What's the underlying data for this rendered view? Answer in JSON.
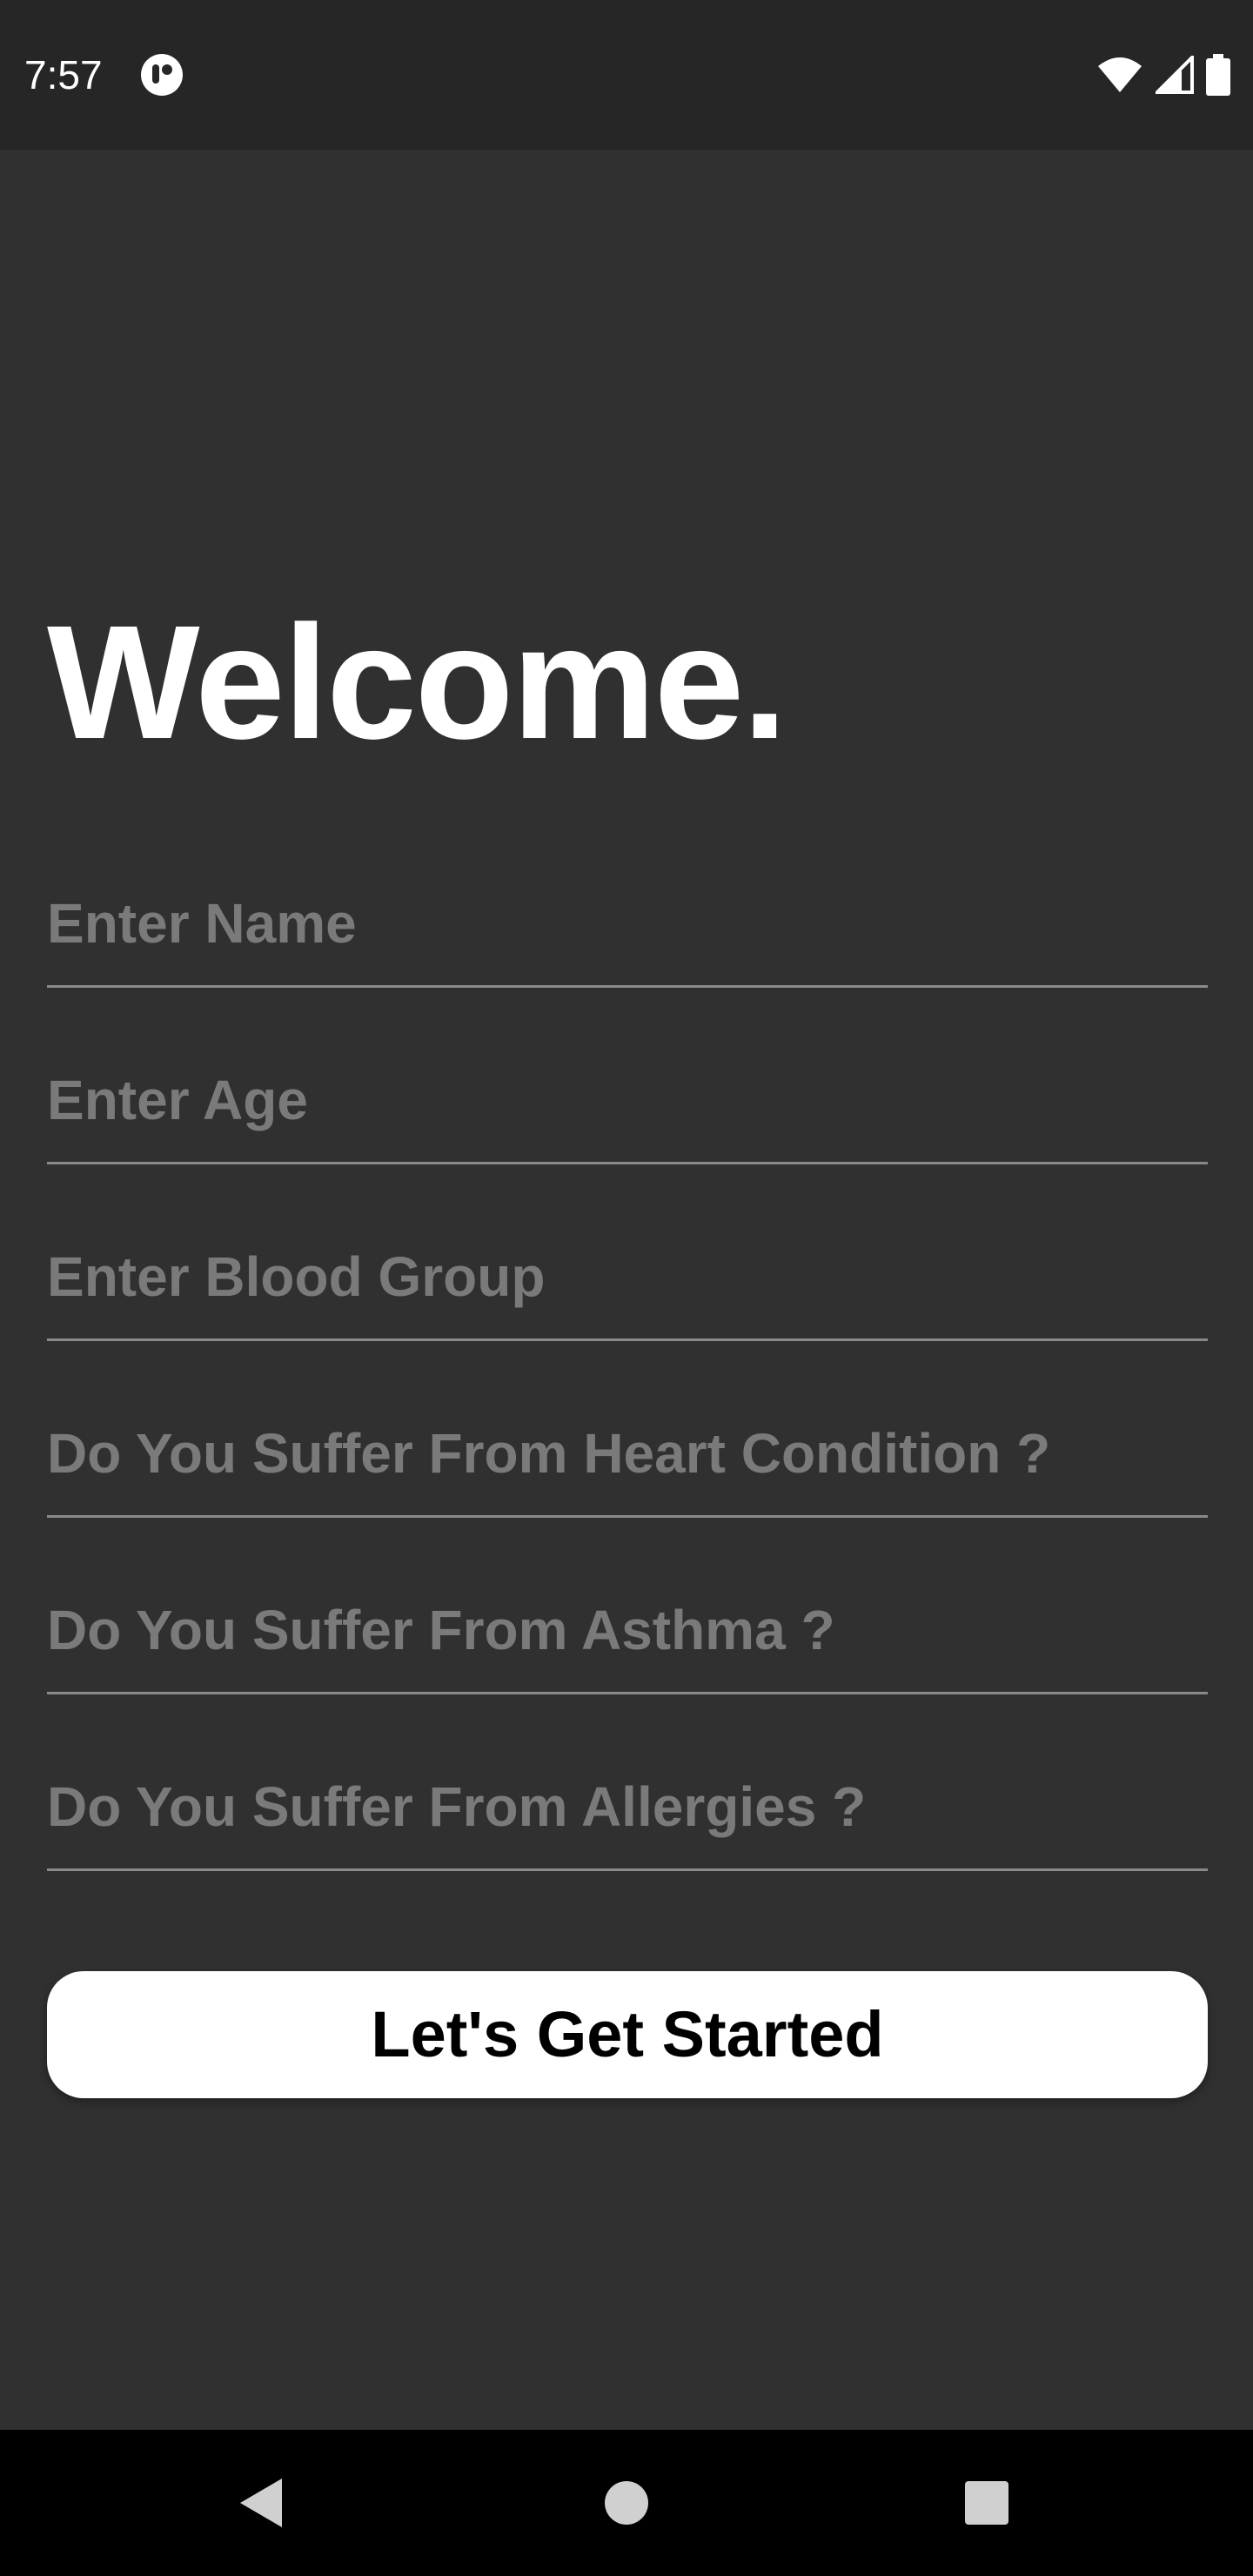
{
  "status_bar": {
    "time": "7:57",
    "icons": [
      "app-notification-icon",
      "wifi-icon",
      "signal-icon",
      "battery-icon"
    ]
  },
  "main": {
    "title": "Welcome.",
    "fields": [
      {
        "name": "name-input",
        "placeholder": "Enter Name",
        "value": ""
      },
      {
        "name": "age-input",
        "placeholder": "Enter Age",
        "value": ""
      },
      {
        "name": "blood-group-input",
        "placeholder": "Enter Blood Group",
        "value": ""
      },
      {
        "name": "heart-condition-input",
        "placeholder": "Do You Suffer From Heart Condition ?",
        "value": ""
      },
      {
        "name": "asthma-input",
        "placeholder": "Do You Suffer From Asthma ?",
        "value": ""
      },
      {
        "name": "allergies-input",
        "placeholder": "Do You Suffer From Allergies ?",
        "value": ""
      }
    ],
    "submit_label": "Let's Get Started"
  },
  "nav_bar": {
    "icons": [
      "back-icon",
      "home-icon",
      "recents-icon"
    ]
  },
  "colors": {
    "background": "#303030",
    "status_bar": "#262626",
    "placeholder": "#7a7a7a",
    "underline": "#8a8a8a",
    "button_bg": "#ffffff",
    "button_text": "#000000"
  }
}
